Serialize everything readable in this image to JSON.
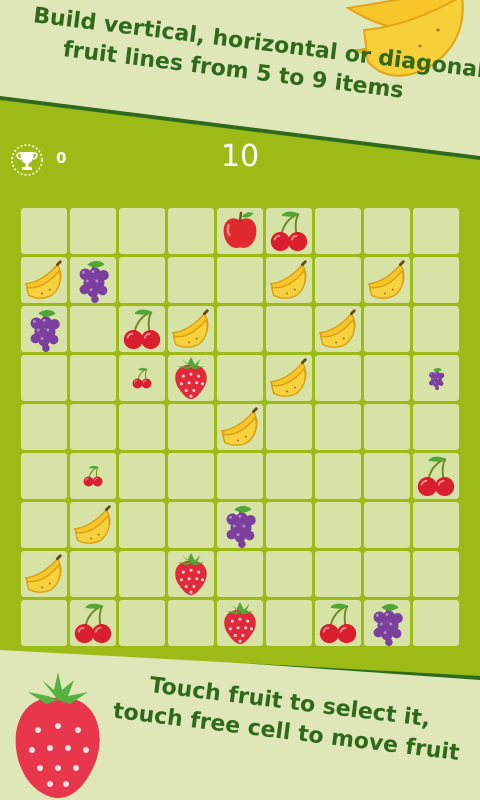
{
  "instructions": {
    "top_line1": "Build vertical, horizontal or diagonal",
    "top_line2": "fruit lines from 5 to 9 items",
    "bottom_line1": "Touch fruit to select it,",
    "bottom_line2": "touch free cell to move fruit"
  },
  "score": {
    "best": "0",
    "current": "10"
  },
  "colors": {
    "band": "#9cbb16",
    "board": "#b6cd5a",
    "cell": "#d7e3a6",
    "text_green": "#2f6a1c"
  },
  "board": {
    "rows": 9,
    "cols": 9,
    "fruits": [
      {
        "row": 0,
        "col": 4,
        "type": "apple",
        "size": "large"
      },
      {
        "row": 0,
        "col": 5,
        "type": "cherry",
        "size": "large"
      },
      {
        "row": 1,
        "col": 0,
        "type": "banana",
        "size": "large"
      },
      {
        "row": 1,
        "col": 1,
        "type": "grapes",
        "size": "large"
      },
      {
        "row": 1,
        "col": 5,
        "type": "banana",
        "size": "large"
      },
      {
        "row": 1,
        "col": 7,
        "type": "banana",
        "size": "large"
      },
      {
        "row": 2,
        "col": 0,
        "type": "grapes",
        "size": "large"
      },
      {
        "row": 2,
        "col": 2,
        "type": "cherry",
        "size": "large"
      },
      {
        "row": 2,
        "col": 3,
        "type": "banana",
        "size": "large"
      },
      {
        "row": 2,
        "col": 6,
        "type": "banana",
        "size": "large"
      },
      {
        "row": 3,
        "col": 2,
        "type": "cherry",
        "size": "small"
      },
      {
        "row": 3,
        "col": 3,
        "type": "strawberry",
        "size": "large"
      },
      {
        "row": 3,
        "col": 5,
        "type": "banana",
        "size": "large"
      },
      {
        "row": 3,
        "col": 8,
        "type": "grapes",
        "size": "small"
      },
      {
        "row": 4,
        "col": 4,
        "type": "banana",
        "size": "large"
      },
      {
        "row": 5,
        "col": 1,
        "type": "cherry",
        "size": "small"
      },
      {
        "row": 5,
        "col": 8,
        "type": "cherry",
        "size": "large"
      },
      {
        "row": 6,
        "col": 1,
        "type": "banana",
        "size": "large"
      },
      {
        "row": 6,
        "col": 4,
        "type": "grapes",
        "size": "large"
      },
      {
        "row": 7,
        "col": 0,
        "type": "banana",
        "size": "large"
      },
      {
        "row": 7,
        "col": 3,
        "type": "strawberry",
        "size": "large"
      },
      {
        "row": 8,
        "col": 1,
        "type": "cherry",
        "size": "large"
      },
      {
        "row": 8,
        "col": 4,
        "type": "strawberry",
        "size": "large"
      },
      {
        "row": 8,
        "col": 6,
        "type": "cherry",
        "size": "large"
      },
      {
        "row": 8,
        "col": 7,
        "type": "grapes",
        "size": "large"
      }
    ]
  }
}
